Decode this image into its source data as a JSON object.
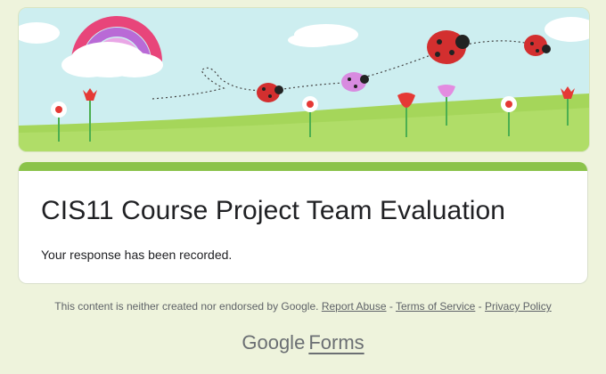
{
  "header": {
    "banner_image": "ladybug-garden-banner"
  },
  "form": {
    "title": "CIS11 Course Project Team Evaluation",
    "confirmation": "Your response has been recorded."
  },
  "footer": {
    "disclaimer": "This content is neither created nor endorsed by Google.",
    "separator": " - ",
    "report_abuse": "Report Abuse",
    "terms": "Terms of Service",
    "privacy": "Privacy Policy"
  },
  "brand": {
    "google": "Google",
    "forms": "Forms"
  },
  "colors": {
    "accent": "#8bc34a",
    "page_background": "#eef3dc",
    "sky": "#cdeef0",
    "grass": "#a5d65a"
  }
}
